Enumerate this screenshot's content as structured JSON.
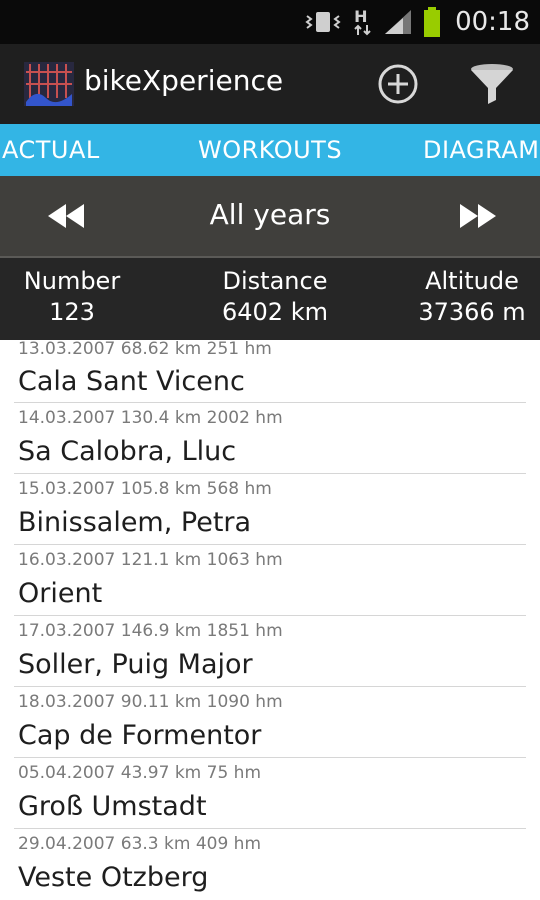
{
  "status_bar": {
    "icons": [
      "vibrate-icon",
      "network-h-icon",
      "signal-icon",
      "battery-icon"
    ],
    "network_label": "H",
    "time": "00:18"
  },
  "app": {
    "title": "bikeXperience",
    "accent_color": "#33b5e5"
  },
  "tabs": [
    {
      "label": "ACTUAL"
    },
    {
      "label": "WORKOUTS"
    },
    {
      "label": "DIAGRAM"
    }
  ],
  "period": {
    "label": "All years"
  },
  "summary": {
    "number_label": "Number",
    "number_value": "123",
    "distance_label": "Distance",
    "distance_value": "6402 km",
    "altitude_label": "Altitude",
    "altitude_value": "37366 m"
  },
  "workouts": [
    {
      "date": "13.03.2007",
      "distance": "68.62 km",
      "altitude": "251 hm",
      "name": "Cala Sant Vicenc"
    },
    {
      "date": "14.03.2007",
      "distance": "130.4 km",
      "altitude": "2002 hm",
      "name": "Sa Calobra, Lluc"
    },
    {
      "date": "15.03.2007",
      "distance": "105.8 km",
      "altitude": "568 hm",
      "name": "Binissalem, Petra"
    },
    {
      "date": "16.03.2007",
      "distance": "121.1 km",
      "altitude": "1063 hm",
      "name": "Orient"
    },
    {
      "date": "17.03.2007",
      "distance": "146.9 km",
      "altitude": "1851 hm",
      "name": "Soller, Puig Major"
    },
    {
      "date": "18.03.2007",
      "distance": "90.11 km",
      "altitude": "1090 hm",
      "name": "Cap de Formentor"
    },
    {
      "date": "05.04.2007",
      "distance": "43.97 km",
      "altitude": "75 hm",
      "name": "Groß Umstadt"
    },
    {
      "date": "29.04.2007",
      "distance": "63.3 km",
      "altitude": "409 hm",
      "name": "Veste Otzberg"
    }
  ]
}
